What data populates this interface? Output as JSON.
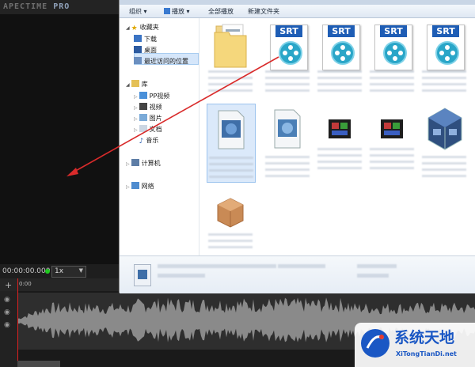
{
  "app": {
    "logo_text": "APECTIME",
    "logo_suffix": "PRO"
  },
  "player": {
    "timecode": "00:00:00.000",
    "speed": "1x"
  },
  "timeline": {
    "ruler_label": "0:00"
  },
  "explorer": {
    "toolbar": [
      "组织 ▾",
      "播放 ▾",
      "全部播放",
      "新建文件夹"
    ],
    "nav": {
      "favorites": "收藏夹",
      "downloads": "下载",
      "desktop": "桌面",
      "recent": "最近访问的位置",
      "libraries": "库",
      "pptv": "PP视频",
      "videos": "视频",
      "pictures": "图片",
      "documents": "文档",
      "music": "音乐",
      "computer": "计算机",
      "network": "网络"
    },
    "srt_files": [
      {
        "label": "SRT"
      },
      {
        "label": "SRT"
      },
      {
        "label": "SRT"
      },
      {
        "label": "SRT"
      }
    ]
  },
  "colors": {
    "accent": "#1e5db5",
    "playhead": "#e02020",
    "arrow": "#d92b2b"
  },
  "watermark": {
    "name": "系统天地",
    "url": "XiTongTianDi.net"
  }
}
